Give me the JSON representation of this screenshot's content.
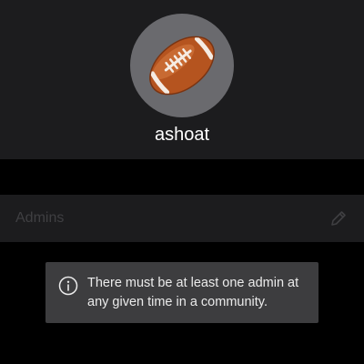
{
  "profile": {
    "avatar_icon": "american-football-icon",
    "username": "ashoat"
  },
  "role": {
    "label": "Admins",
    "edit_icon": "pencil-icon"
  },
  "toast": {
    "icon": "info-circle-icon",
    "message": "There must be at least one admin at any given time in a community."
  }
}
